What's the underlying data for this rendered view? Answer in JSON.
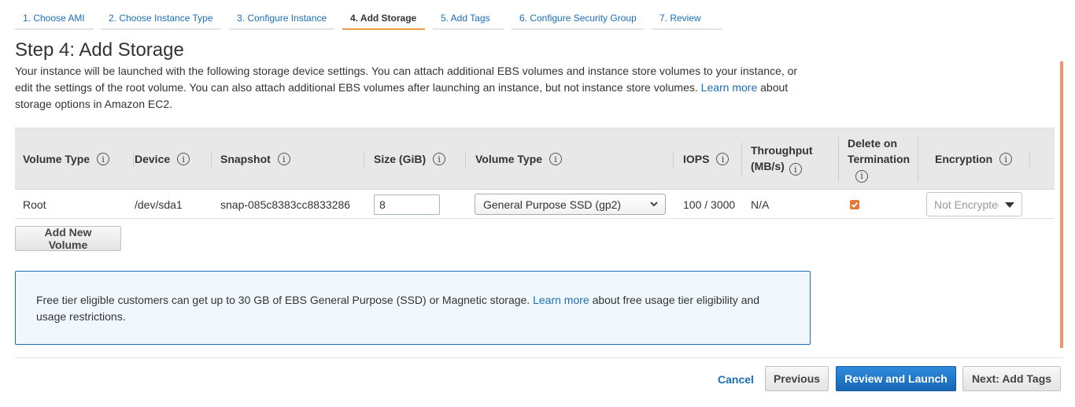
{
  "steps": [
    {
      "label": "1. Choose AMI"
    },
    {
      "label": "2. Choose Instance Type"
    },
    {
      "label": "3. Configure Instance"
    },
    {
      "label": "4. Add Storage"
    },
    {
      "label": "5. Add Tags"
    },
    {
      "label": "6. Configure Security Group"
    },
    {
      "label": "7. Review"
    }
  ],
  "title": "Step 4: Add Storage",
  "intro": {
    "text": "Your instance will be launched with the following storage device settings. You can attach additional EBS volumes and instance store volumes to your instance, or edit the settings of the root volume. You can also attach additional EBS volumes after launching an instance, but not instance store volumes.",
    "link": "Learn more",
    "suffix": "about storage options in Amazon EC2."
  },
  "table": {
    "headers": {
      "volume_type": "Volume Type",
      "device": "Device",
      "snapshot": "Snapshot",
      "size": "Size (GiB)",
      "ebs_type": "Volume Type",
      "iops": "IOPS",
      "throughput_1": "Throughput",
      "throughput_2": "(MB/s)",
      "delete_1": "Delete on",
      "delete_2": "Termination",
      "encryption": "Encryption"
    },
    "info_glyph": "i",
    "row": {
      "volume_type": "Root",
      "device": "/dev/sda1",
      "snapshot": "snap-085c8383cc8833286",
      "size": "8",
      "ebs_type": "General Purpose SSD (gp2)",
      "iops": "100 / 3000",
      "throughput": "N/A",
      "delete_on_termination": true,
      "encryption": "Not Encrypted"
    }
  },
  "add_volume_label": "Add New Volume",
  "notice": {
    "text": "Free tier eligible customers can get up to 30 GB of EBS General Purpose (SSD) or Magnetic storage.",
    "link": "Learn more",
    "suffix": "about free usage tier eligibility and usage restrictions."
  },
  "footer": {
    "cancel": "Cancel",
    "previous": "Previous",
    "review_launch": "Review and Launch",
    "next": "Next: Add Tags"
  },
  "colors": {
    "accent_link": "#1a6eb8",
    "active_step": "#ec9f47",
    "primary_button": "#1f78cd",
    "checkbox": "#e07b39"
  }
}
